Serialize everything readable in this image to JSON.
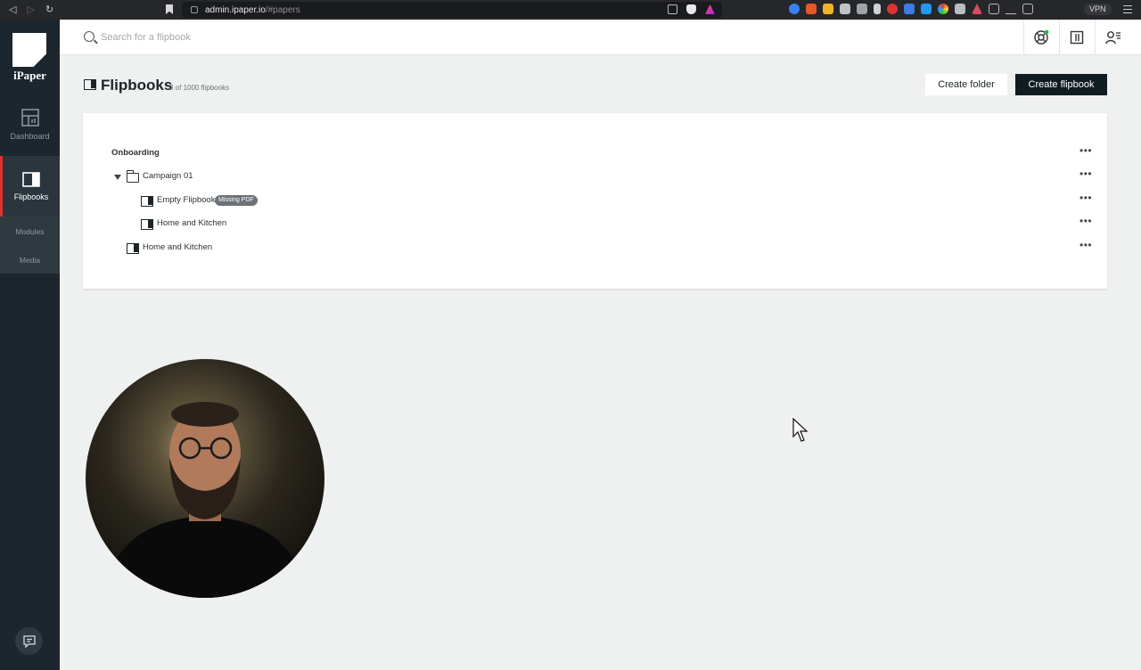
{
  "browser": {
    "url_host": "admin.ipaper.io",
    "url_path": "/#papers",
    "vpn_label": "VPN"
  },
  "sidebar": {
    "logo_text": "iPaper",
    "items": [
      {
        "label": "Dashboard",
        "icon": "dashboard-icon"
      },
      {
        "label": "Flipbooks",
        "icon": "flipbook-icon",
        "active": true
      }
    ],
    "sub_items": [
      {
        "label": "Modules"
      },
      {
        "label": "Media"
      }
    ]
  },
  "topbar": {
    "search_placeholder": "Search for a flipbook",
    "icons": [
      "support-icon",
      "columns-icon",
      "user-settings-icon"
    ]
  },
  "header": {
    "title": "Flipbooks",
    "count": "3 of 1000 flipbooks",
    "create_folder_label": "Create folder",
    "create_flipbook_label": "Create flipbook"
  },
  "tree": {
    "root": "Onboarding",
    "folder": "Campaign 01",
    "items": [
      {
        "label": "Empty Flipbook",
        "badge": "Missing PDF"
      },
      {
        "label": "Home and Kitchen"
      },
      {
        "label": "Home and Kitchen"
      }
    ],
    "more_label": "•••"
  },
  "colors": {
    "sidebar_bg": "#1b262e",
    "accent_red": "#e0322d",
    "primary_button": "#111c22",
    "page_bg": "#eff0f0"
  }
}
